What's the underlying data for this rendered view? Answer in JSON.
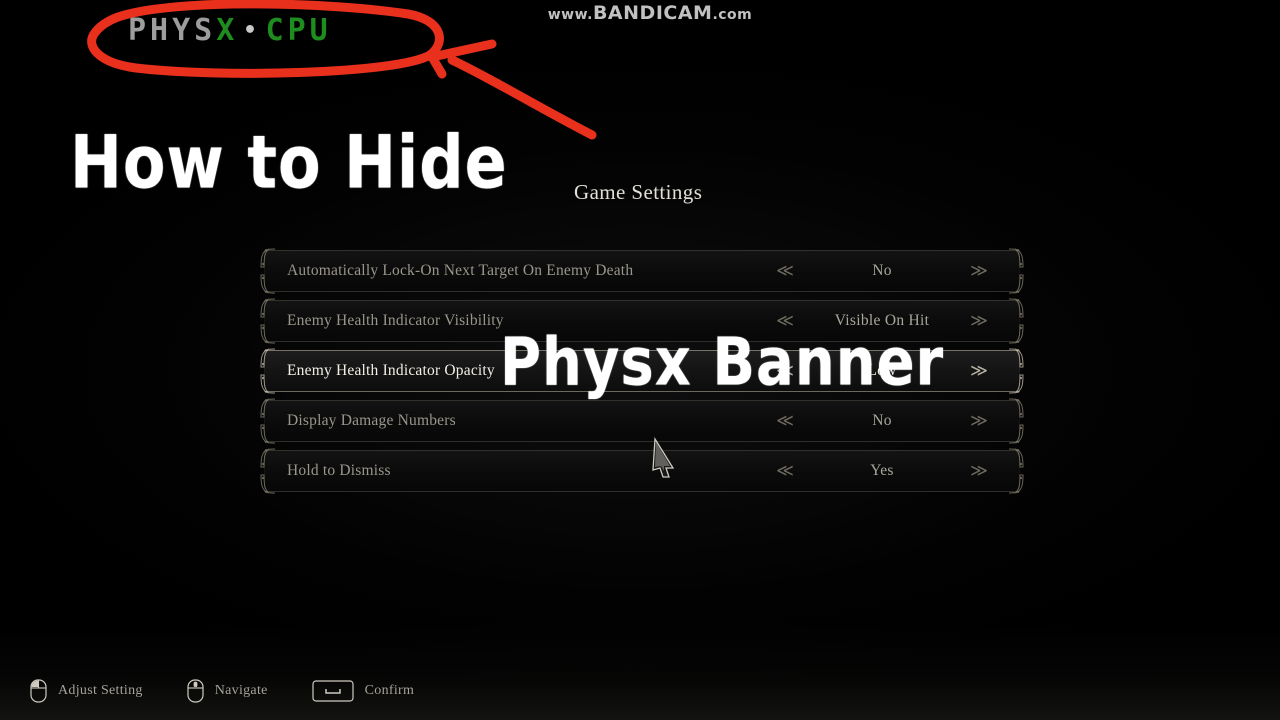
{
  "watermark": {
    "prefix": "www.",
    "brand": "BANDICAM",
    "suffix": ".com"
  },
  "physx_banner": {
    "part_gray": "PHYS",
    "part_x": "X",
    "separator": "•",
    "part_cpu": "CPU",
    "color_gray": "#9d9d9d",
    "color_green": "#1f8c1f"
  },
  "annotations": {
    "caption_top": "How to Hide",
    "caption_middle": "Physx Banner",
    "marker_color": "#e8301c"
  },
  "game": {
    "title": "Game Settings",
    "rows": [
      {
        "label": "Automatically Lock-On Next Target On Enemy Death",
        "value": "No",
        "selected": false
      },
      {
        "label": "Enemy Health Indicator Visibility",
        "value": "Visible On Hit",
        "selected": false
      },
      {
        "label": "Enemy Health Indicator Opacity",
        "value": "Low",
        "selected": true
      },
      {
        "label": "Display Damage Numbers",
        "value": "No",
        "selected": false
      },
      {
        "label": "Hold to Dismiss",
        "value": "Yes",
        "selected": false
      }
    ],
    "arrow_left": "≪",
    "arrow_right": "≫"
  },
  "hints": [
    {
      "icon": "mouse-left-click-icon",
      "label": "Adjust Setting"
    },
    {
      "icon": "mouse-scroll-wheel-icon",
      "label": "Navigate"
    },
    {
      "icon": "spacebar-key-icon",
      "label": "Confirm"
    }
  ]
}
